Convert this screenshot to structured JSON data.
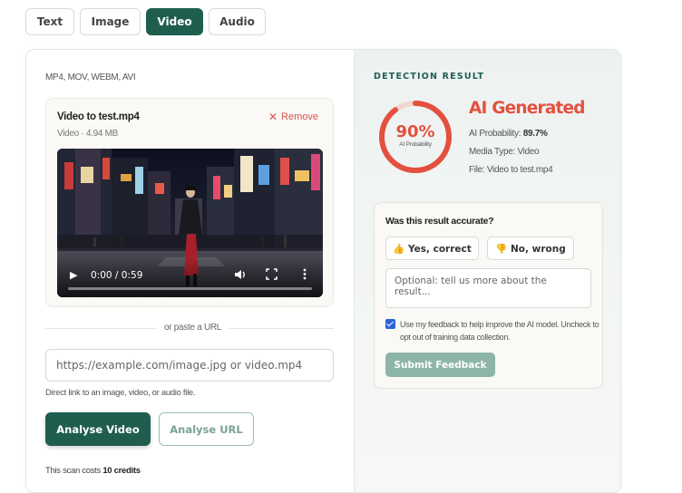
{
  "tabs": [
    {
      "label": "Text",
      "active": false
    },
    {
      "label": "Image",
      "active": false
    },
    {
      "label": "Video",
      "active": true
    },
    {
      "label": "Audio",
      "active": false
    }
  ],
  "upload": {
    "formats": "MP4, MOV, WEBM, AVI",
    "file_name": "Video to test.mp4",
    "file_meta": "Video · 4.94 MB",
    "remove_label": "Remove",
    "player": {
      "current_time": "0:00",
      "duration": "0:59",
      "time_display": "0:00 / 0:59",
      "progress": 0
    }
  },
  "url_section": {
    "divider_text": "or paste a URL",
    "placeholder": "https://example.com/image.jpg or video.mp4",
    "hint": "Direct link to an image, video, or audio file.",
    "analyse_video_label": "Analyse Video",
    "analyse_url_label": "Analyse URL",
    "cost_prefix": "This scan costs",
    "cost_value": "10 credits"
  },
  "result": {
    "section_title": "DETECTION RESULT",
    "gauge_percent": "90%",
    "gauge_value": 0.897,
    "gauge_label": "AI Probability",
    "verdict": "AI Generated",
    "probability_label": "AI Probability:",
    "probability_value": "89.7%",
    "media_type": "Media Type: Video",
    "file": "File: Video to test.mp4",
    "accent_color": "#e4503f"
  },
  "feedback": {
    "question": "Was this result accurate?",
    "yes_label": "Yes, correct",
    "no_label": "No, wrong",
    "placeholder": "Optional: tell us more about the result...",
    "consent_checked": true,
    "consent_text": "Use my feedback to help improve the AI model. Uncheck to opt out of training data collection.",
    "submit_label": "Submit Feedback"
  },
  "colors": {
    "brand": "#1f5e4f",
    "danger": "#e4503f",
    "checkbox": "#2b63d9"
  }
}
